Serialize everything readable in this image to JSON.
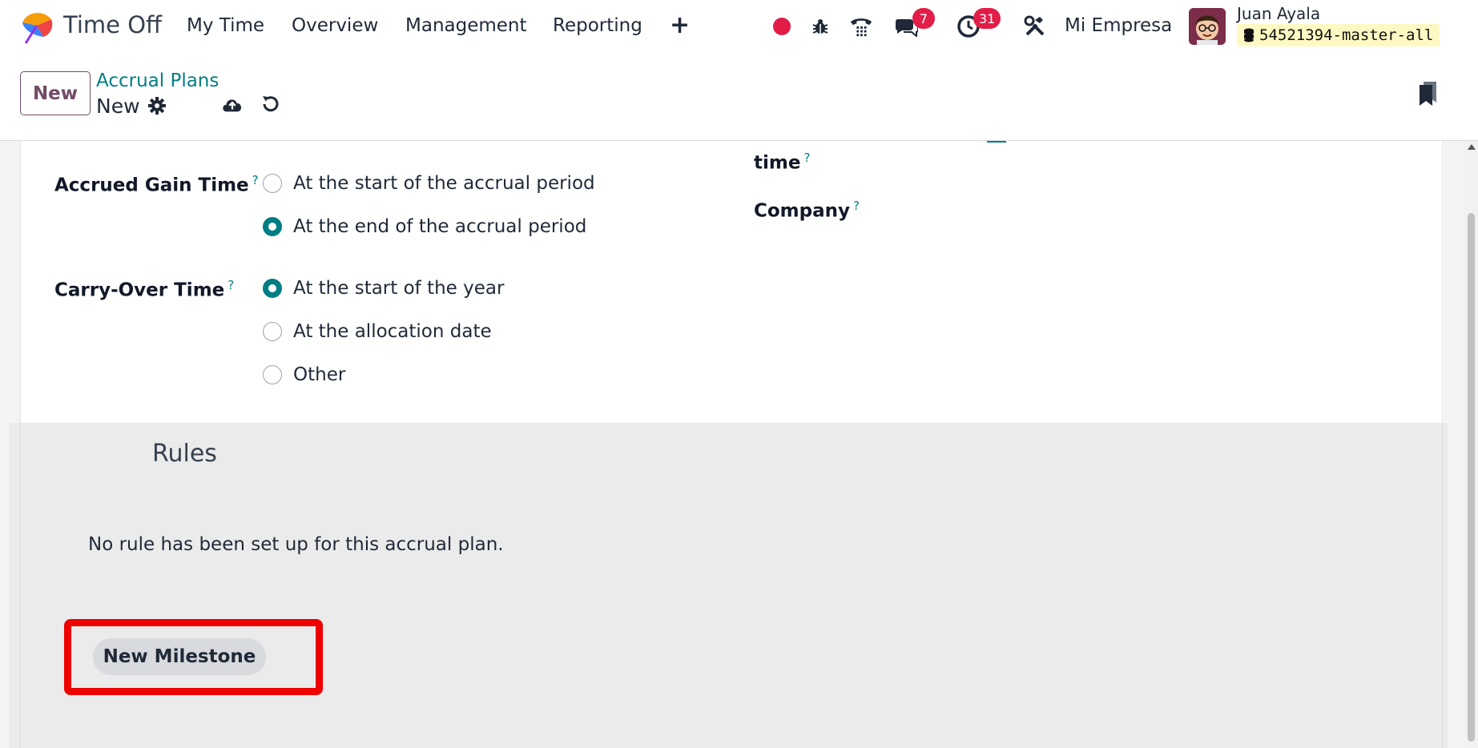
{
  "navbar": {
    "app_name": "Time Off",
    "menu": [
      "My Time",
      "Overview",
      "Management",
      "Reporting"
    ],
    "chat_badge": "7",
    "activity_badge": "31",
    "company": "Mi Empresa",
    "user_name": "Juan Ayala",
    "database": "54521394-master-all"
  },
  "control": {
    "new_button": "New",
    "breadcrumb_parent": "Accrual Plans",
    "breadcrumb_current": "New"
  },
  "form": {
    "accrued_gain_time": {
      "label": "Accrued Gain Time",
      "help": "?",
      "options": [
        "At the start of the accrual period",
        "At the end of the accrual period"
      ],
      "selected": "At the end of the accrual period"
    },
    "carry_over_time": {
      "label": "Carry-Over Time",
      "help": "?",
      "options": [
        "At the start of the year",
        "At the allocation date",
        "Other"
      ],
      "selected": "At the start of the year"
    },
    "right_time_label": "time",
    "company_label": "Company"
  },
  "rules": {
    "title": "Rules",
    "empty_message": "No rule has been set up for this accrual plan.",
    "new_milestone_button": "New Milestone"
  },
  "colors": {
    "primary": "#714b67",
    "accent": "#017e84",
    "badge": "#e11d48",
    "highlight": "#ee0000"
  }
}
